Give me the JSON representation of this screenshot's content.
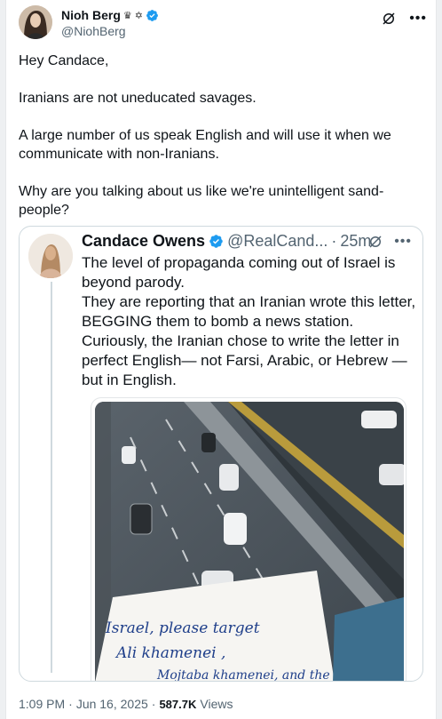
{
  "tweet": {
    "author_name": "Nioh Berg",
    "author_emoji": "♛ ✡",
    "author_handle": "@NiohBerg",
    "text_paragraphs": [
      "Hey Candace,",
      "Iranians are not uneducated savages.",
      "A large number of us speak English and will use it when we communicate with non-Iranians.",
      "Why are you talking about us like we're unintelligent sand-people?"
    ],
    "time": "1:09 PM",
    "date": "Jun 16, 2025",
    "views_count": "587.7K",
    "views_label": "Views"
  },
  "quoted": {
    "author_name": "Candace Owens",
    "author_handle": "@RealCand...",
    "age": "25m",
    "text": "The level of propaganda coming out of Israel is beyond parody.\nThey are reporting that an Iranian wrote this letter, BEGGING them to bomb a news station. Curiously, the Iranian chose to write the letter in perfect English— not Farsi, Arabic, or Hebrew — but in English.",
    "note_lines": [
      "Israel, please target",
      "Ali khamenei ,",
      "Mojtaba khamenei, and the"
    ]
  },
  "icons": {
    "verified": "verified-badge-icon",
    "grok": "grok-icon",
    "more": "more-icon"
  },
  "colors": {
    "verified_blue": "#1d9bf0",
    "secondary_text": "#536471",
    "border": "#cfd9de"
  }
}
